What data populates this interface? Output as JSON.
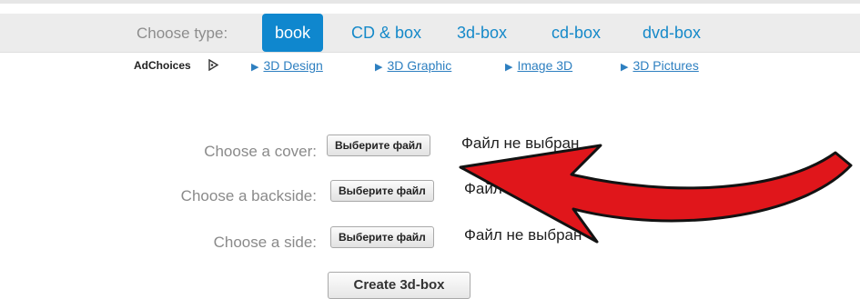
{
  "type_bar": {
    "label": "Choose type:",
    "tabs": [
      {
        "label": "book",
        "active": true
      },
      {
        "label": "CD & box",
        "active": false
      },
      {
        "label": "3d-box",
        "active": false
      },
      {
        "label": "cd-box",
        "active": false
      },
      {
        "label": "dvd-box",
        "active": false
      }
    ]
  },
  "ads": {
    "adchoices_label": "AdChoices",
    "links": [
      "3D Design",
      "3D Graphic",
      "Image 3D",
      "3D Pictures"
    ]
  },
  "uploads": [
    {
      "label": "Choose a cover:",
      "button": "Выберите файл",
      "status": "Файл не выбран"
    },
    {
      "label": "Choose a backside:",
      "button": "Выберите файл",
      "status": "Файл не выбран"
    },
    {
      "label": "Choose a side:",
      "button": "Выберите файл",
      "status": "Файл не выбран"
    }
  ],
  "create_button": "Create 3d-box",
  "colors": {
    "accent": "#0f87ce",
    "link": "#1589c9",
    "arrow": "#e0161b"
  }
}
